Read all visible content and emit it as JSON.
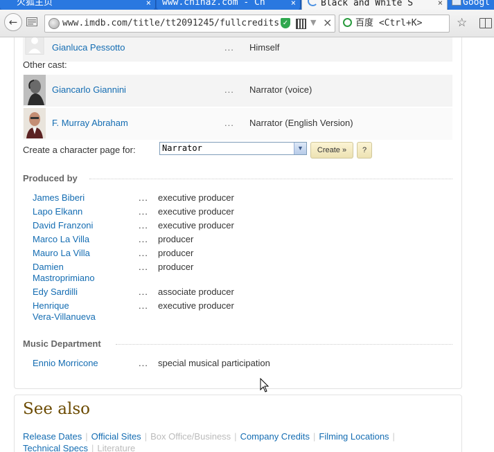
{
  "browser": {
    "tabs": [
      {
        "label": "火狐主页",
        "active": false
      },
      {
        "label": "www.chinaz.com - Ch",
        "active": false
      },
      {
        "label": "Black and White S",
        "active": true
      },
      {
        "label": "Googl",
        "active": false
      }
    ],
    "tab_close_glyph": "×",
    "url": "www.imdb.com/title/tt2091245/fullcredits",
    "search_placeholder": "百度 <Ctrl+K>",
    "back_glyph": "←",
    "url_clear_glyph": "×",
    "url_dropdown_glyph": "▼",
    "star_glyph": "☆"
  },
  "cast": {
    "top_row": {
      "name": "Gianluca Pessotto",
      "role": "Himself"
    },
    "other_cast_label": "Other cast:",
    "dots": "...",
    "rows": [
      {
        "name": "Giancarlo Giannini",
        "role": "Narrator (voice)"
      },
      {
        "name": "F. Murray Abraham",
        "role": "Narrator (English Version)"
      }
    ]
  },
  "character_page": {
    "label": "Create a character page for:",
    "selected": "Narrator",
    "create_button": "Create »",
    "help_button": "?"
  },
  "produced_by": {
    "heading": "Produced by",
    "dots": "...",
    "rows": [
      {
        "name": "James Biberi",
        "role": "executive producer"
      },
      {
        "name": "Lapo Elkann",
        "role": "executive producer"
      },
      {
        "name": "David Franzoni",
        "role": "executive producer"
      },
      {
        "name": "Marco La Villa",
        "role": "producer"
      },
      {
        "name": "Mauro La Villa",
        "role": "producer"
      },
      {
        "name": "Damien\nMastroprimiano",
        "role": "producer"
      },
      {
        "name": "Edy Sardilli",
        "role": "associate producer"
      },
      {
        "name": "Henrique\nVera-Villanueva",
        "role": "executive producer"
      }
    ]
  },
  "music_department": {
    "heading": "Music Department",
    "dots": "...",
    "rows": [
      {
        "name": "Ennio Morricone",
        "role": "special musical participation"
      }
    ]
  },
  "see_also": {
    "heading": "See also",
    "links": [
      {
        "label": "Release Dates",
        "enabled": true
      },
      {
        "label": "Official Sites",
        "enabled": true
      },
      {
        "label": "Box Office/Business",
        "enabled": false
      },
      {
        "label": "Company Credits",
        "enabled": true
      },
      {
        "label": "Filming Locations",
        "enabled": true
      },
      {
        "label": "Technical Specs",
        "enabled": true
      },
      {
        "label": "Literature",
        "enabled": false
      }
    ],
    "separator": "|"
  },
  "colors": {
    "link": "#136cb2",
    "tabstrip": "#1d63c8",
    "see_also_heading": "#6b4a00",
    "button_bg": "#f5ebc4"
  }
}
